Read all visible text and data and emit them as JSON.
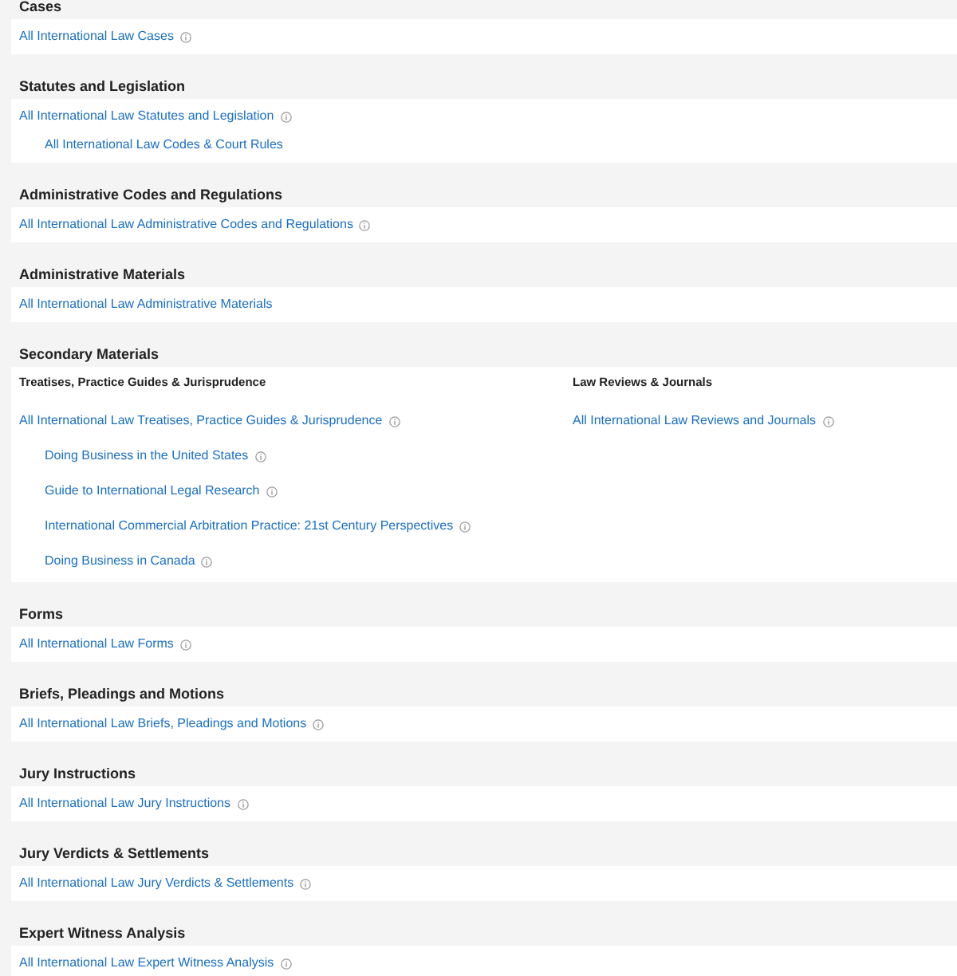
{
  "sections": [
    {
      "title": "Cases",
      "kind": "simple",
      "links": [
        {
          "text": "All International Law Cases",
          "info": true
        }
      ]
    },
    {
      "title": "Statutes and Legislation",
      "kind": "simple",
      "links": [
        {
          "text": "All International Law Statutes and Legislation",
          "info": true,
          "children": [
            {
              "text": "All International Law Codes & Court Rules",
              "info": false
            }
          ]
        }
      ]
    },
    {
      "title": "Administrative Codes and Regulations",
      "kind": "simple",
      "links": [
        {
          "text": "All International Law Administrative Codes and Regulations",
          "info": true
        }
      ]
    },
    {
      "title": "Administrative Materials",
      "kind": "simple",
      "links": [
        {
          "text": "All International Law Administrative Materials",
          "info": false
        }
      ]
    },
    {
      "title": "Secondary Materials",
      "kind": "columns",
      "columns": [
        {
          "heading": "Treatises, Practice Guides & Jurisprudence",
          "links": [
            {
              "text": "All International Law Treatises, Practice Guides & Jurisprudence",
              "info": true,
              "children": [
                {
                  "text": "Doing Business in the United States",
                  "info": true
                },
                {
                  "text": "Guide to International Legal Research",
                  "info": true
                },
                {
                  "text": "International Commercial Arbitration Practice: 21st Century Perspectives",
                  "info": true
                },
                {
                  "text": "Doing Business in Canada",
                  "info": true
                }
              ]
            }
          ]
        },
        {
          "heading": "Law Reviews & Journals",
          "links": [
            {
              "text": "All International Law Reviews and Journals",
              "info": true
            }
          ]
        }
      ]
    },
    {
      "title": "Forms",
      "kind": "simple",
      "links": [
        {
          "text": "All International Law Forms",
          "info": true
        }
      ]
    },
    {
      "title": "Briefs, Pleadings and Motions",
      "kind": "simple",
      "links": [
        {
          "text": "All International Law Briefs, Pleadings and Motions",
          "info": true
        }
      ]
    },
    {
      "title": "Jury Instructions",
      "kind": "simple",
      "links": [
        {
          "text": "All International Law Jury Instructions",
          "info": true
        }
      ]
    },
    {
      "title": "Jury Verdicts & Settlements",
      "kind": "simple",
      "links": [
        {
          "text": "All International Law Jury Verdicts & Settlements",
          "info": true
        }
      ]
    },
    {
      "title": "Expert Witness Analysis",
      "kind": "simple",
      "links": [
        {
          "text": "All International Law Expert Witness Analysis",
          "info": true
        }
      ]
    }
  ]
}
